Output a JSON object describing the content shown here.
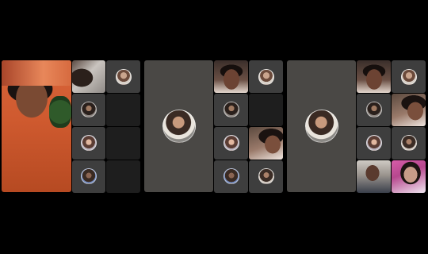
{
  "call": {
    "panels": [
      {
        "id": "panel-1",
        "kind": "grid-with-self-view"
      },
      {
        "id": "panel-2",
        "kind": "grid-with-focused-participant"
      },
      {
        "id": "panel-3",
        "kind": "grid-with-focused-participant"
      }
    ],
    "icons": {
      "participant_avatar": "circular-avatar-icon",
      "video_tile": "video-feed-tile"
    },
    "colors": {
      "background": "#000000",
      "tile_gray": "#3e3e3e",
      "tile_dark": "#1e1e1e",
      "stage_gray": "#4a4845",
      "self_view_accent": "#d9643a"
    }
  }
}
